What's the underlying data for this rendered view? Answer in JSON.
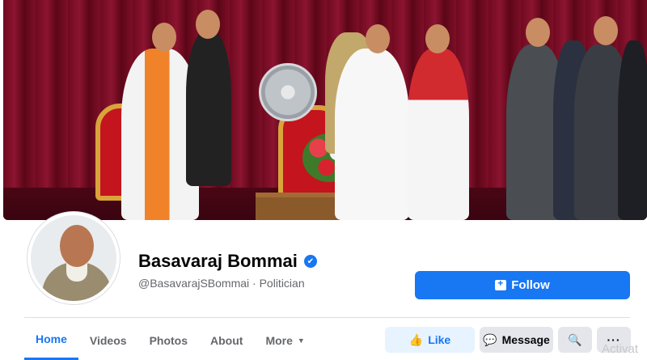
{
  "profile": {
    "name": "Basavaraj Bommai",
    "handle_line": "@BasavarajSBommai · Politician"
  },
  "buttons": {
    "follow": "Follow",
    "like": "Like",
    "message": "Message"
  },
  "tabs": [
    {
      "label": "Home"
    },
    {
      "label": "Videos"
    },
    {
      "label": "Photos"
    },
    {
      "label": "About"
    },
    {
      "label": "More"
    }
  ],
  "watermark": "Activat",
  "icons": {
    "verified": "verified-badge-icon",
    "follow": "follow-plus-icon",
    "like": "thumbs-up-icon",
    "message": "messenger-icon",
    "search": "search-icon",
    "more": "ellipsis-icon"
  },
  "colors": {
    "accent": "#1877f2",
    "muted": "#65676b",
    "button_bg": "#e4e6eb"
  }
}
